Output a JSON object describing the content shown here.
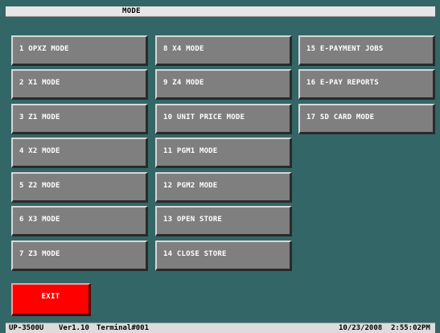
{
  "window": {
    "title": "MODE"
  },
  "columns": [
    {
      "items": [
        {
          "label": "1 OPXZ MODE"
        },
        {
          "label": "2 X1 MODE"
        },
        {
          "label": "3 Z1 MODE"
        },
        {
          "label": "4 X2 MODE"
        },
        {
          "label": "5 Z2 MODE"
        },
        {
          "label": "6 X3 MODE"
        },
        {
          "label": "7 Z3 MODE"
        }
      ]
    },
    {
      "items": [
        {
          "label": "8 X4 MODE"
        },
        {
          "label": "9 Z4 MODE"
        },
        {
          "label": "10 UNIT PRICE MODE"
        },
        {
          "label": "11 PGM1 MODE"
        },
        {
          "label": "12 PGM2 MODE"
        },
        {
          "label": "13 OPEN STORE"
        },
        {
          "label": "14 CLOSE STORE"
        }
      ]
    },
    {
      "items": [
        {
          "label": "15 E-PAYMENT JOBS"
        },
        {
          "label": "16 E-PAY REPORTS"
        },
        {
          "label": "17 SD CARD MODE"
        }
      ]
    }
  ],
  "exit": {
    "label": "EXIT"
  },
  "status": {
    "model": "UP-3500U",
    "version": "Ver1.10",
    "terminal": "Terminal#001",
    "date": "10/23/2008",
    "time": "2:55:02PM"
  },
  "colors": {
    "background": "#336666",
    "button": "#7f7f7f",
    "exit_button": "#ff0000"
  }
}
